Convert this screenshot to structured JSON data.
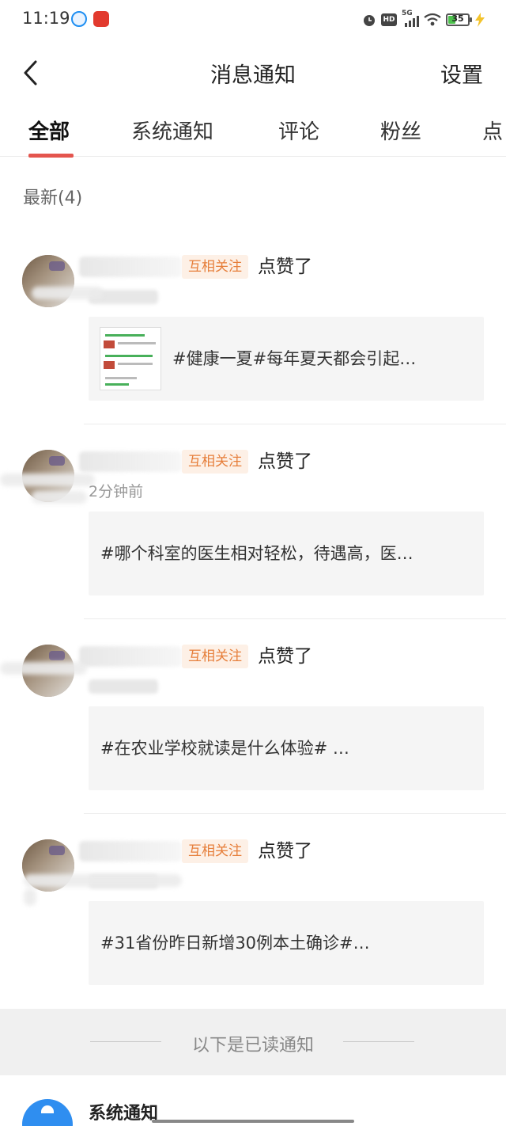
{
  "status_bar": {
    "time": "11:19",
    "network": "5G",
    "hd_label": "HD",
    "battery": "35"
  },
  "nav": {
    "title": "消息通知",
    "settings_label": "设置"
  },
  "tabs": [
    "全部",
    "系统通知",
    "评论",
    "粉丝",
    "点"
  ],
  "active_tab": "全部",
  "section": {
    "title": "最新(4)"
  },
  "notifications": [
    {
      "badge": "互相关注",
      "action": "点赞了",
      "time": "",
      "has_thumbnail": true,
      "content": "#健康一夏#每年夏天都会引起…"
    },
    {
      "badge": "互相关注",
      "action": "点赞了",
      "time": "2分钟前",
      "has_thumbnail": false,
      "content": "#哪个科室的医生相对轻松，待遇高，医…"
    },
    {
      "badge": "互相关注",
      "action": "点赞了",
      "time": "",
      "has_thumbnail": false,
      "content": "#在农业学校就读是什么体验# …"
    },
    {
      "badge": "互相关注",
      "action": "点赞了",
      "time": "",
      "has_thumbnail": false,
      "content": "#31省份昨日新增30例本土确诊#…"
    }
  ],
  "read_divider": "以下是已读通知",
  "system_item": {
    "title": "系统通知"
  },
  "colors": {
    "accent": "#e4554e",
    "badge_bg": "#fdf0e6",
    "badge_text": "#e67e3a",
    "system_avatar": "#2f8ef0"
  }
}
